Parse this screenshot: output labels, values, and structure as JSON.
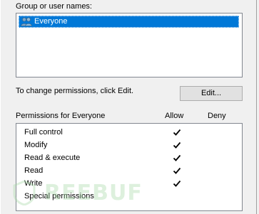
{
  "group_label": "Group or user names:",
  "users": [
    {
      "name": "Everyone",
      "icon": "users-group-icon",
      "selected": true
    }
  ],
  "change_hint": "To change permissions, click Edit.",
  "edit_button": "Edit...",
  "permissions_header": {
    "title": "Permissions for Everyone",
    "allow": "Allow",
    "deny": "Deny"
  },
  "permissions": [
    {
      "name": "Full control",
      "allow": true,
      "deny": false
    },
    {
      "name": "Modify",
      "allow": true,
      "deny": false
    },
    {
      "name": "Read & execute",
      "allow": true,
      "deny": false
    },
    {
      "name": "Read",
      "allow": true,
      "deny": false
    },
    {
      "name": "Write",
      "allow": true,
      "deny": false
    },
    {
      "name": "Special permissions",
      "allow": false,
      "deny": false
    }
  ],
  "watermark": "REEBUF",
  "colors": {
    "selection": "#0078d7",
    "watermark": "#9fd7a0"
  }
}
